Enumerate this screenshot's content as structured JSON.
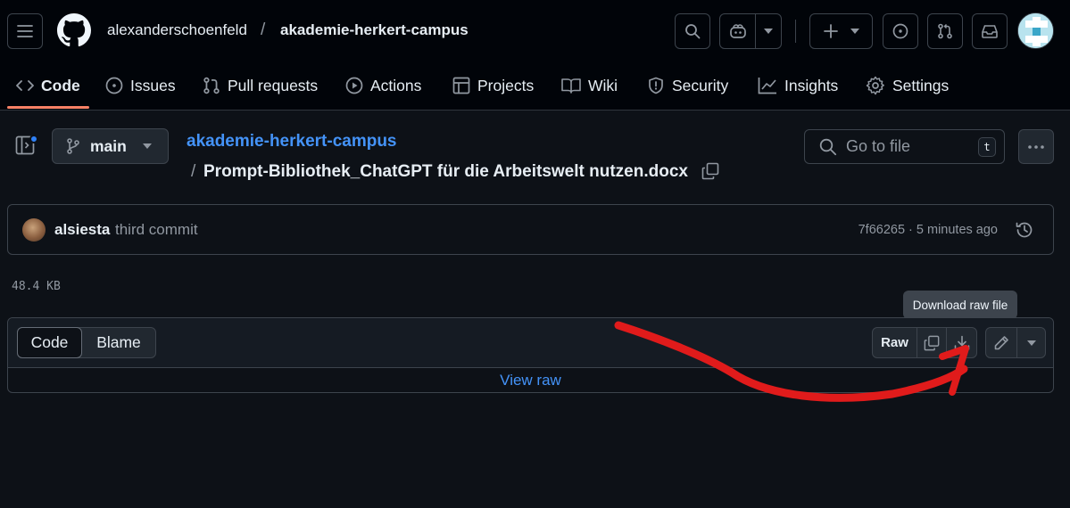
{
  "header": {
    "owner": "alexanderschoenfeld",
    "separator": "/",
    "repo": "akademie-herkert-campus"
  },
  "nav": {
    "tabs": [
      {
        "label": "Code",
        "icon": "code-icon",
        "active": true
      },
      {
        "label": "Issues",
        "icon": "issue-opened-icon"
      },
      {
        "label": "Pull requests",
        "icon": "git-pull-request-icon"
      },
      {
        "label": "Actions",
        "icon": "play-icon"
      },
      {
        "label": "Projects",
        "icon": "table-icon"
      },
      {
        "label": "Wiki",
        "icon": "book-icon"
      },
      {
        "label": "Security",
        "icon": "shield-icon"
      },
      {
        "label": "Insights",
        "icon": "graph-icon"
      },
      {
        "label": "Settings",
        "icon": "gear-icon"
      }
    ]
  },
  "file_header": {
    "branch": "main",
    "repo_link": "akademie-herkert-campus",
    "path_separator": "/",
    "file_name": "Prompt-Bibliothek_ChatGPT für die Arbeitswelt nutzen.docx",
    "goto_placeholder": "Go to file",
    "goto_shortcut": "t"
  },
  "commit": {
    "author": "alsiesta",
    "message": "third commit",
    "meta": "7f66265 · 5 minutes ago"
  },
  "file_size": "48.4 KB",
  "viewer": {
    "tabs": [
      "Code",
      "Blame"
    ],
    "raw_label": "Raw",
    "view_raw": "View raw",
    "tooltip": "Download raw file"
  },
  "colors": {
    "accent_link": "#4493f8",
    "active_tab_underline": "#f78166",
    "annotation_arrow": "#e01b1b",
    "notification_dot": "#2f81f7"
  }
}
